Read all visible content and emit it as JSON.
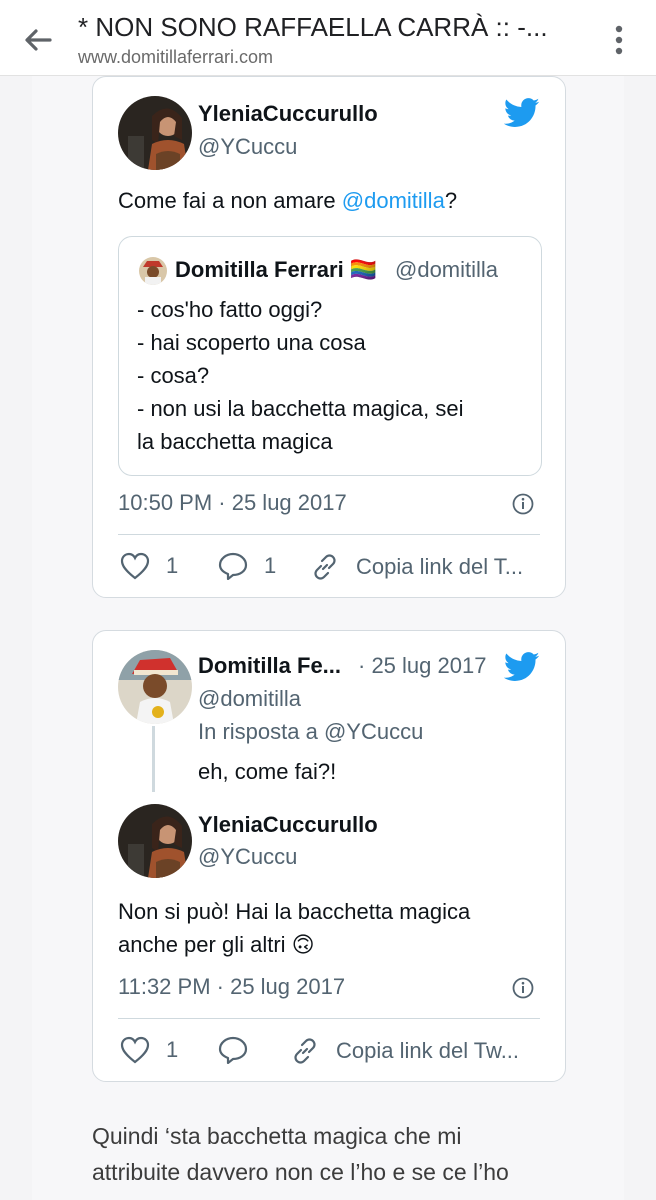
{
  "browser": {
    "title": "* NON SONO RAFFAELLA CARRÀ :: -...",
    "url": "www.domitillaferrari.com"
  },
  "tweet1": {
    "name": "YleniaCuccurullo",
    "handle": "@YCuccu",
    "text_before": "Come fai a non amare ",
    "mention": "@domitilla",
    "text_after": "?",
    "quote": {
      "name": "Domitilla Ferrari",
      "flag": "🏳️‍🌈",
      "handle": "@domitilla",
      "lines": [
        "- cos'ho fatto oggi?",
        "- hai scoperto una cosa",
        "- cosa?",
        "- non usi la bacchetta magica, sei",
        "la bacchetta magica"
      ]
    },
    "timestamp": "10:50 PM · 25 lug 2017",
    "likes": "1",
    "replies": "1",
    "copy_link": "Copia link del T..."
  },
  "tweet2": {
    "parent": {
      "name": "Domitilla Fe...",
      "date": "· 25 lug 2017",
      "handle": "@domitilla",
      "reply_to": "In risposta a @YCuccu",
      "text": "eh, come fai?!"
    },
    "name": "YleniaCuccurullo",
    "handle": "@YCuccu",
    "text_line1": "Non si può! Hai la bacchetta magica",
    "text_line2": "anche per gli altri",
    "emoji": "🙃",
    "timestamp": "11:32 PM · 25 lug 2017",
    "likes": "1",
    "copy_link": "Copia link del Tw..."
  },
  "article": {
    "line1": "Quindi ‘sta bacchetta magica che mi",
    "line2": "attribuite davvero non ce l’ho e se ce l’ho"
  },
  "colors": {
    "twitter_blue": "#1d9bf0",
    "text_dark": "#0f1419",
    "text_grey": "#536471"
  }
}
